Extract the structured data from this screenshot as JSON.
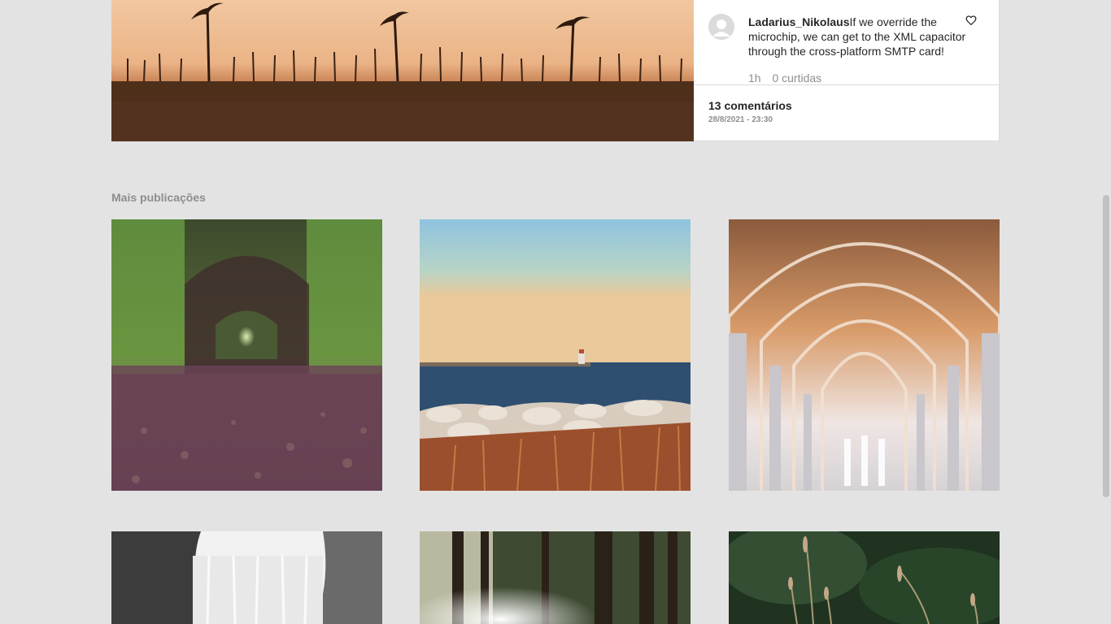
{
  "post": {
    "image_alt": "palm-trees-sunset",
    "comment": {
      "username": "Ladarius_Nikolaus",
      "text": "If we override the microchip, we can get to the XML capacitor through the cross-platform SMTP card!",
      "time": "1h",
      "likes": "0 curtidas"
    },
    "comments_count": "13 comentários",
    "date": "28/8/2021 - 23:30"
  },
  "more_posts": {
    "title": "Mais publicações",
    "items": [
      {
        "image": "forest-tunnel-path"
      },
      {
        "image": "lake-lighthouse-shore"
      },
      {
        "image": "church-interior-arches"
      },
      {
        "image": "waterfall"
      },
      {
        "image": "forest-sunlight"
      },
      {
        "image": "grass-closeup"
      }
    ]
  },
  "icons": {
    "avatar": "user-avatar-icon",
    "like": "heart-icon"
  }
}
